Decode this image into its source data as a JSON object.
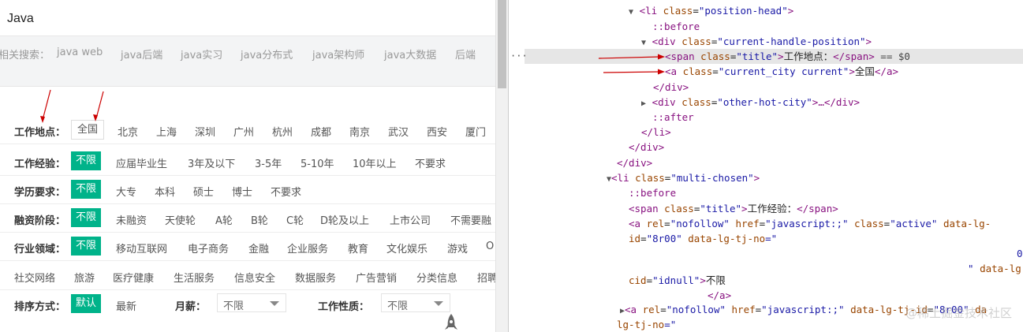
{
  "search": {
    "value": "Java"
  },
  "related": {
    "label": "相关搜索：",
    "keywords": [
      "java web",
      "java后端",
      "java实习",
      "java分布式",
      "java架构师",
      "java大数据",
      "后端"
    ]
  },
  "filters": {
    "location": {
      "title": "工作地点：",
      "options": [
        "全国",
        "北京",
        "上海",
        "深圳",
        "广州",
        "杭州",
        "成都",
        "南京",
        "武汉",
        "西安",
        "厦门"
      ]
    },
    "experience": {
      "title": "工作经验：",
      "options": [
        "不限",
        "应届毕业生",
        "3年及以下",
        "3-5年",
        "5-10年",
        "10年以上",
        "不要求"
      ]
    },
    "education": {
      "title": "学历要求：",
      "options": [
        "不限",
        "大专",
        "本科",
        "硕士",
        "博士",
        "不要求"
      ]
    },
    "funding": {
      "title": "融资阶段：",
      "options": [
        "不限",
        "未融资",
        "天使轮",
        "A轮",
        "B轮",
        "C轮",
        "D轮及以上",
        "上市公司",
        "不需要融"
      ]
    },
    "industry": {
      "title": "行业领域：",
      "options": [
        "不限",
        "移动互联网",
        "电子商务",
        "金融",
        "企业服务",
        "教育",
        "文化娱乐",
        "游戏",
        "O"
      ]
    },
    "industry2": {
      "options": [
        "社交网络",
        "旅游",
        "医疗健康",
        "生活服务",
        "信息安全",
        "数据服务",
        "广告营销",
        "分类信息",
        "招聘"
      ]
    },
    "sort": {
      "title": "排序方式：",
      "options": [
        "默认",
        "最新"
      ],
      "salary_title": "月薪：",
      "salary_value": "不限",
      "nature_title": "工作性质：",
      "nature_value": "不限"
    }
  },
  "devtools": {
    "l1": {
      "tag_open": "<li",
      "attr": "class",
      "val": "\"position-head\"",
      "close": ">"
    },
    "l2": "::before",
    "l3": {
      "tag_open": "<div",
      "attr": "class",
      "val": "\"current-handle-position\"",
      "close": ">"
    },
    "l4": {
      "tag_open": "<span",
      "attr": "class",
      "val": "\"title\"",
      "close": ">",
      "text": "工作地点：",
      "end": "</span>",
      "eq": " == $0"
    },
    "l5": {
      "tag_open": "<a",
      "attr": "class",
      "val": "\"current_city current\"",
      "close": ">",
      "text": "全国",
      "end": "</a>"
    },
    "l6": "</div>",
    "l7": {
      "tag_open": "<div",
      "attr": "class",
      "val": "\"other-hot-city\"",
      "close": ">…</div>"
    },
    "l8": "::after",
    "l9": "</li>",
    "l10": "</div>",
    "l11": "</div>",
    "l12": {
      "tag_open": "<li",
      "attr": "class",
      "val": "\"multi-chosen\"",
      "close": ">"
    },
    "l13": "::before",
    "l14": {
      "tag_open": "<span",
      "attr": "class",
      "val": "\"title\"",
      "close": ">",
      "text": "工作经验：",
      "end": "</span>"
    },
    "l15": {
      "tag_open": "<a",
      "a1": "rel",
      "v1": "\"nofollow\"",
      "a2": "href",
      "v2": "\"javascript:;\"",
      "a3": "class",
      "v3": "\"active\"",
      "a4": "data-lg-"
    },
    "l16": {
      "a": "id",
      "v": "\"8r00\"",
      "a2": "data-lg-tj-no",
      "v2": "=\""
    },
    "l17": "0",
    "l18": {
      "v": "\"",
      "a": "data-lg"
    },
    "l19": {
      "a": "cid",
      "v": "\"idnull\"",
      "close": ">",
      "text": "不限"
    },
    "l20": "</a>",
    "l21": {
      "tag_open": "<a",
      "a1": "rel",
      "v1": "\"nofollow\"",
      "a2": "href",
      "v2": "\"javascript:;\"",
      "a3": "data-lg-tj-id",
      "v3": "\"8r00\"",
      "a4": "da"
    },
    "l22": {
      "a": "lg-tj-no",
      "v": "=\""
    }
  },
  "watermark": "@稀土掘金技术社区",
  "colors": {
    "accent": "#00b38a",
    "tag": "#881280",
    "attr": "#994500",
    "value": "#1a1aa6",
    "arrow": "#cc0000"
  }
}
